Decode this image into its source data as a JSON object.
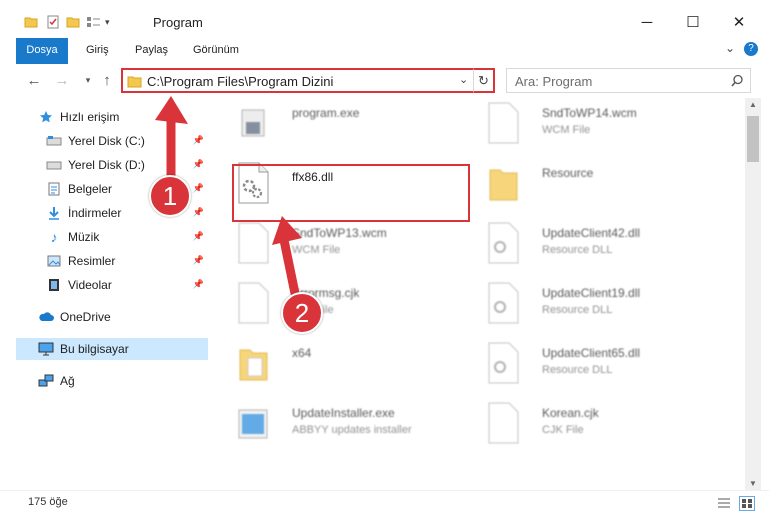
{
  "window": {
    "title": "Program",
    "minimize": "─",
    "maximize": "☐",
    "close": "✕"
  },
  "ribbon": {
    "tabs": [
      "Dosya",
      "Giriş",
      "Paylaş",
      "Görünüm"
    ],
    "expand": "⌄",
    "help": "?"
  },
  "address": {
    "path": "C:\\Program Files\\Program Dizini",
    "search_placeholder": "Ara: Program"
  },
  "sidebar": {
    "items": [
      {
        "label": "Hızlı erişim",
        "icon": "star-icon"
      },
      {
        "label": "Yerel Disk (C:)",
        "icon": "drive-icon"
      },
      {
        "label": "Yerel Disk (D:)",
        "icon": "drive-icon"
      },
      {
        "label": "Belgeler",
        "icon": "documents-icon"
      },
      {
        "label": "İndirmeler",
        "icon": "download-icon"
      },
      {
        "label": "Müzik",
        "icon": "music-icon"
      },
      {
        "label": "Resimler",
        "icon": "pictures-icon"
      },
      {
        "label": "Videolar",
        "icon": "videos-icon"
      },
      {
        "label": "OneDrive",
        "icon": "cloud-icon"
      },
      {
        "label": "Bu bilgisayar",
        "icon": "computer-icon"
      },
      {
        "label": "Ağ",
        "icon": "network-icon"
      }
    ]
  },
  "files": {
    "left": [
      {
        "name": "program.exe",
        "type": ""
      },
      {
        "name": "ffx86.dll",
        "type": ""
      },
      {
        "name": "SndToWP13.wcm",
        "type": "WCM File"
      },
      {
        "name": "Errormsg.cjk",
        "type": "CJK File"
      },
      {
        "name": "x64",
        "type": ""
      },
      {
        "name": "UpdateInstaller.exe",
        "type": "ABBYY updates installer"
      }
    ],
    "right": [
      {
        "name": "SndToWP14.wcm",
        "type": "WCM File"
      },
      {
        "name": "Resource",
        "type": ""
      },
      {
        "name": "UpdateClient42.dll",
        "type": "Resource DLL"
      },
      {
        "name": "UpdateClient19.dll",
        "type": "Resource DLL"
      },
      {
        "name": "UpdateClient65.dll",
        "type": "Resource DLL"
      },
      {
        "name": "Korean.cjk",
        "type": "CJK File"
      }
    ]
  },
  "status": {
    "count": "175 öğe"
  },
  "annotations": {
    "badge1": "1",
    "badge2": "2"
  },
  "colors": {
    "accent": "#1979ca",
    "highlight": "#d8343a",
    "selection": "#cce8ff"
  }
}
